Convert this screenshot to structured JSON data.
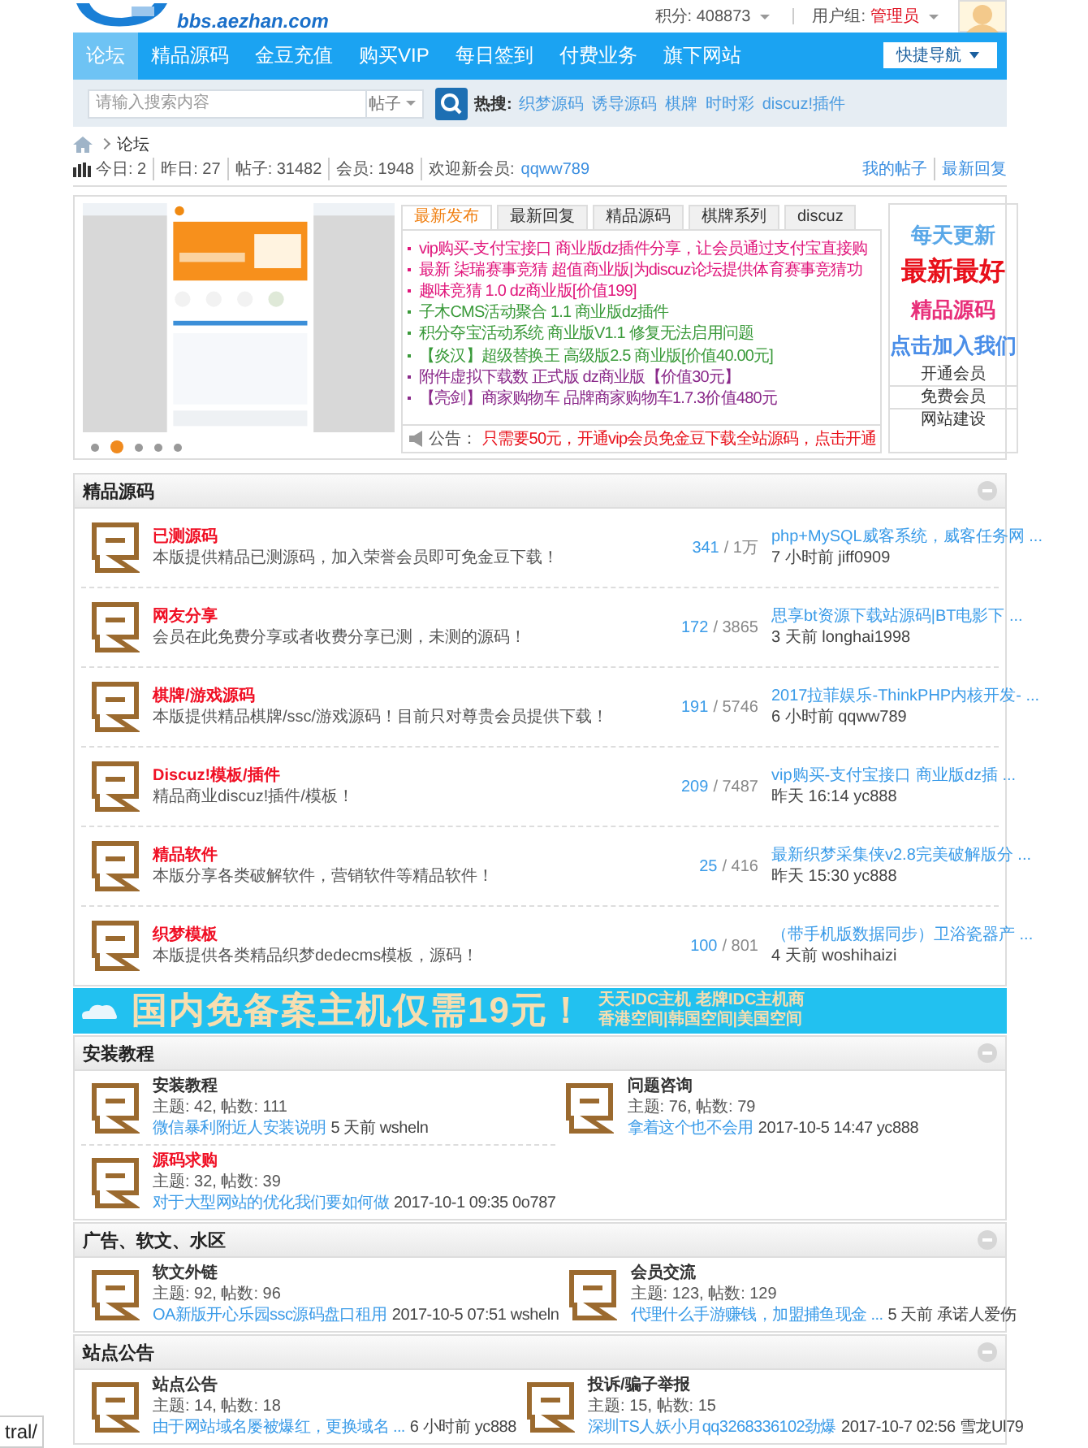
{
  "header": {
    "site_url": "bbs.aezhan.com",
    "points": "积分: 408873",
    "usergroup_label": "用户组:",
    "usergroup": "管理员"
  },
  "nav": {
    "items": [
      {
        "label": "论坛",
        "selected": true
      },
      {
        "label": "精品源码",
        "selected": false
      },
      {
        "label": "金豆充值",
        "selected": false
      },
      {
        "label": "购买VIP",
        "selected": false
      },
      {
        "label": "每日签到",
        "selected": false
      },
      {
        "label": "付费业务",
        "selected": false
      },
      {
        "label": "旗下网站",
        "selected": false
      }
    ],
    "quick_nav": "快捷导航"
  },
  "search": {
    "placeholder": "请输入搜索内容",
    "scope": "帖子",
    "hot_label": "热搜:",
    "hot": [
      "织梦源码",
      "诱导源码",
      "棋牌",
      "时时彩",
      "discuz!插件"
    ]
  },
  "breadcrumb": [
    "论坛"
  ],
  "stats": {
    "items": [
      "今日: 2",
      "昨日: 27",
      "帖子: 31482",
      "会员: 1948"
    ],
    "new_member_label": "欢迎新会员:",
    "new_member": "qqww789",
    "links": [
      "我的帖子",
      "最新回复"
    ]
  },
  "hot": {
    "slide_dots": [
      {
        "selected": false
      },
      {
        "selected": true
      },
      {
        "selected": false
      },
      {
        "selected": false
      },
      {
        "selected": false
      }
    ],
    "tabs": [
      {
        "label": "最新发布",
        "selected": true
      },
      {
        "label": "最新回复",
        "selected": false
      },
      {
        "label": "精品源码",
        "selected": false
      },
      {
        "label": "棋牌系列",
        "selected": false
      },
      {
        "label": "discuz",
        "selected": false
      }
    ],
    "posts": [
      {
        "title": "vip购买-支付宝接口 商业版dz插件分享，让会员通过支付宝直接购",
        "color": "#e0157a"
      },
      {
        "title": "最新 柒瑞赛事竞猜 超值商业版|为discuz论坛提供体育赛事竞猜功",
        "color": "#e0157a"
      },
      {
        "title": "趣味竞猜 1.0 dz商业版[价值199]",
        "color": "#e0157a"
      },
      {
        "title": "子木CMS活动聚合 1.1 商业版dz插件",
        "color": "#3a9a3a"
      },
      {
        "title": "积分夺宝活动系统 商业版V1.1 修复无法启用问题",
        "color": "#3a9a3a"
      },
      {
        "title": "【炎汉】超级替换王 高级版2.5 商业版[价值40.00元]",
        "color": "#3a9a3a"
      },
      {
        "title": "附件虚拟下载数 正式版 dz商业版【价值30元】",
        "color": "#8a2a8a"
      },
      {
        "title": "【亮剑】商家购物车 品牌商家购物车1.7.3价值480元",
        "color": "#8a2a8a"
      }
    ],
    "notice_label": "公告：",
    "notice": "只需要50元，开通vip会员免金豆下载全站源码，点击开通",
    "promo": [
      {
        "text": "每天更新",
        "kind": "normal",
        "color": "#5aa8e8"
      },
      {
        "text": "最新最好",
        "kind": "big",
        "color": "#e8101a"
      },
      {
        "text": "精品源码",
        "kind": "normal",
        "color": "#e8307a"
      },
      {
        "text": "点击加入我们",
        "kind": "normal",
        "color": "#4a8ee8"
      }
    ],
    "links": [
      "开通会员",
      "免费会员",
      "网站建设"
    ]
  },
  "sections": [
    {
      "title": "精品源码",
      "kind": "list",
      "forums": [
        {
          "name": "已测源码",
          "highlighted": true,
          "description": "本版提供精品已测源码，加入荣誉会员即可免金豆下载！",
          "threads": "341",
          "posts": "/ 1万",
          "last_post": "php+MySQL威客系统，威客任务网 ...",
          "last_info": "7 小时前 jiff0909"
        },
        {
          "name": "网友分享",
          "highlighted": true,
          "description": "会员在此免费分享或者收费分享已测，未测的源码！",
          "threads": "172",
          "posts": "/ 3865",
          "last_post": "思享bt资源下载站源码|BT电影下 ...",
          "last_info": "3 天前 longhai1998"
        },
        {
          "name": "棋牌/游戏源码",
          "highlighted": true,
          "description": "本版提供精品棋牌/ssc/游戏源码！目前只对尊贵会员提供下载！",
          "threads": "191",
          "posts": "/ 5746",
          "last_post": "2017拉菲娱乐-ThinkPHP内核开发- ...",
          "last_info": "6 小时前 qqww789"
        },
        {
          "name": "Discuz!模板/插件",
          "highlighted": true,
          "description": "精品商业discuz!插件/模板！",
          "threads": "209",
          "posts": "/ 7487",
          "last_post": "vip购买-支付宝接口 商业版dz插 ...",
          "last_info": "昨天 16:14 yc888"
        },
        {
          "name": "精品软件",
          "highlighted": true,
          "description": "本版分享各类破解软件，营销软件等精品软件！",
          "threads": "25",
          "posts": "/ 416",
          "last_post": "最新织梦采集侠v2.8完美破解版分 ...",
          "last_info": "昨天 15:30 yc888"
        },
        {
          "name": "织梦模板",
          "highlighted": true,
          "description": "本版提供各类精品织梦dedecms模板，源码！",
          "threads": "100",
          "posts": "/ 801",
          "last_post": "（带手机版数据同步）卫浴瓷器产 ...",
          "last_info": "4 天前 woshihaizi"
        }
      ]
    },
    {
      "kind": "banner",
      "headline": "国内免备案主机仅需19元！",
      "line_1": "天天IDC主机 老牌IDC主机商",
      "line_2": "香港空间|韩国空间|美国空间"
    },
    {
      "title": "安装教程",
      "kind": "grid",
      "forums": [
        {
          "name": "安装教程",
          "highlighted": false,
          "stats": "主题: 42, 帖数: 111",
          "last_post": "微信暴利附近人安装说明",
          "last_info": "5 天前 wsheln"
        },
        {
          "name": "问题咨询",
          "highlighted": false,
          "stats": "主题: 76, 帖数: 79",
          "last_post": "拿着这个也不会用",
          "last_info": "2017-10-5 14:47 yc888"
        },
        {
          "name": "源码求购",
          "highlighted": true,
          "stats": "主题: 32, 帖数: 39",
          "last_post": "对于大型网站的优化我们要如何做",
          "last_info": "2017-10-1 09:35 0o787"
        }
      ]
    },
    {
      "title": "广告、软文、水区",
      "kind": "grid",
      "forums": [
        {
          "name": "软文外链",
          "highlighted": false,
          "stats": "主题: 92, 帖数: 96",
          "last_post": "OA新版开心乐园ssc源码盘口租用",
          "last_info": "2017-10-5 07:51 wsheln"
        },
        {
          "name": "会员交流",
          "highlighted": false,
          "stats": "主题: 123, 帖数: 129",
          "last_post": "代理什么手游赚钱，加盟捕鱼现金 ...",
          "last_info": "5 天前 承诺人爱伤"
        }
      ]
    },
    {
      "title": "站点公告",
      "kind": "grid",
      "forums": [
        {
          "name": "站点公告",
          "highlighted": false,
          "stats": "主题: 14, 帖数: 18",
          "last_post": "由于网站域名屡被爆红，更换域名 ...",
          "last_info": "6 小时前 yc888"
        },
        {
          "name": "投诉/骗子举报",
          "highlighted": false,
          "stats": "主题: 15, 帖数: 15",
          "last_post": "深圳TS人妖小月qq3268336102劲爆",
          "last_info": "2017-10-7 02:56 雪龙Ul79"
        }
      ]
    }
  ],
  "status_url": "tral/"
}
